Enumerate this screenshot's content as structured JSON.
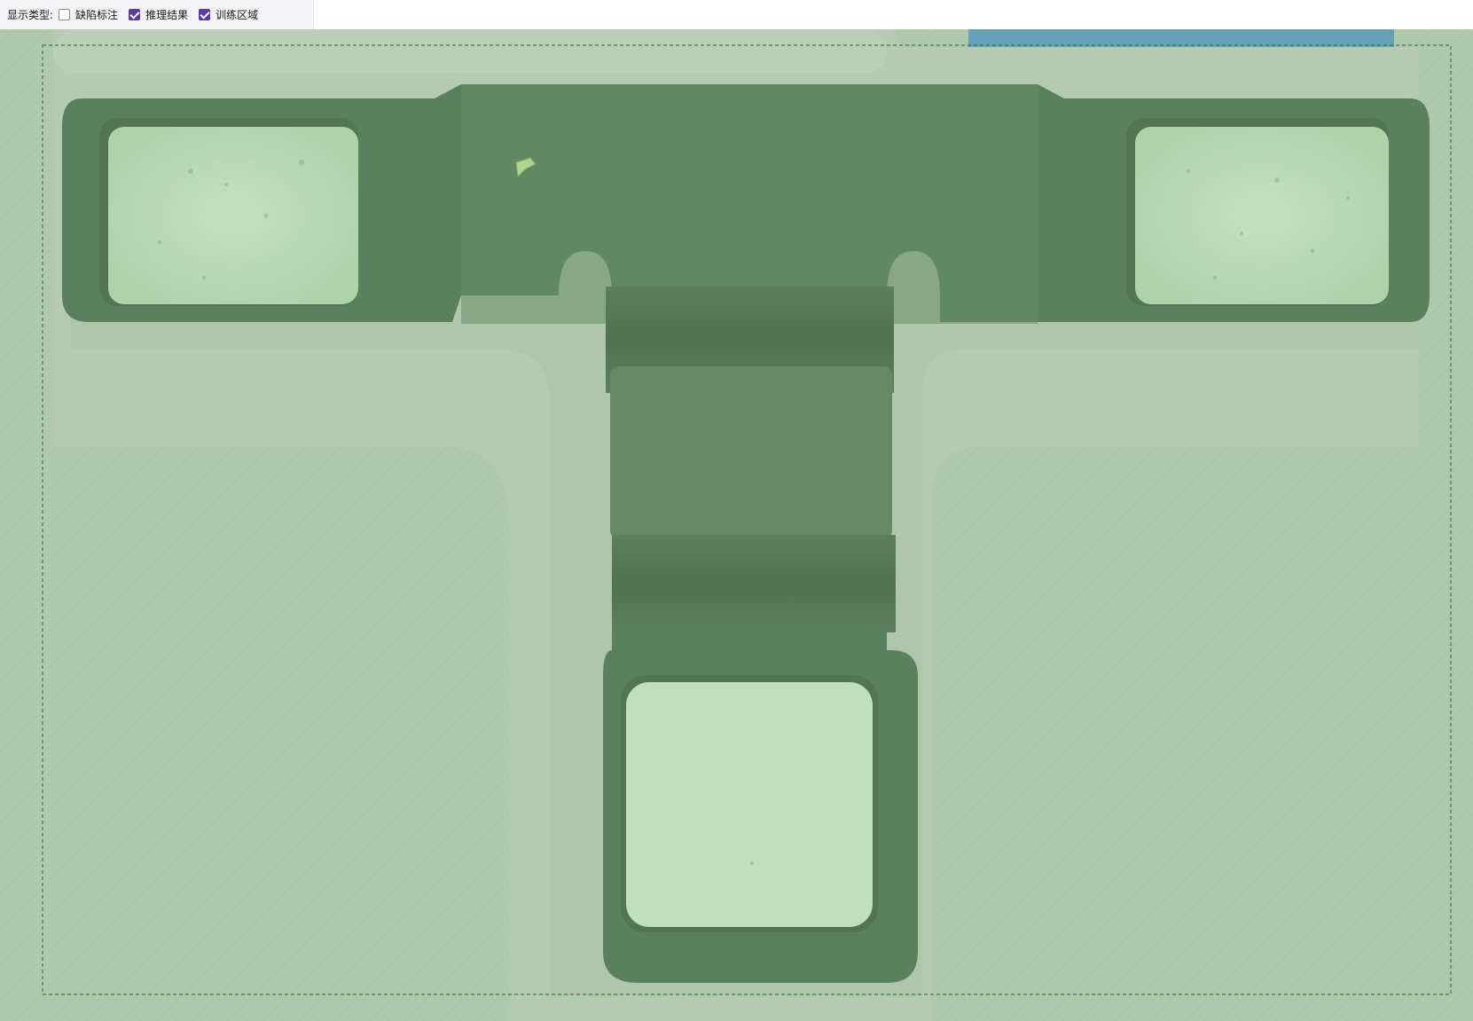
{
  "toolbar": {
    "display_type_label": "显示类型:",
    "options": [
      {
        "label": "缺陷标注",
        "checked": false
      },
      {
        "label": "推理结果",
        "checked": true
      },
      {
        "label": "训练区域",
        "checked": true
      }
    ]
  },
  "colors": {
    "checkbox_accent": "#5b3aa3",
    "overlay_green": "#9fcf9a",
    "roi_border": "#3f7a3f"
  }
}
